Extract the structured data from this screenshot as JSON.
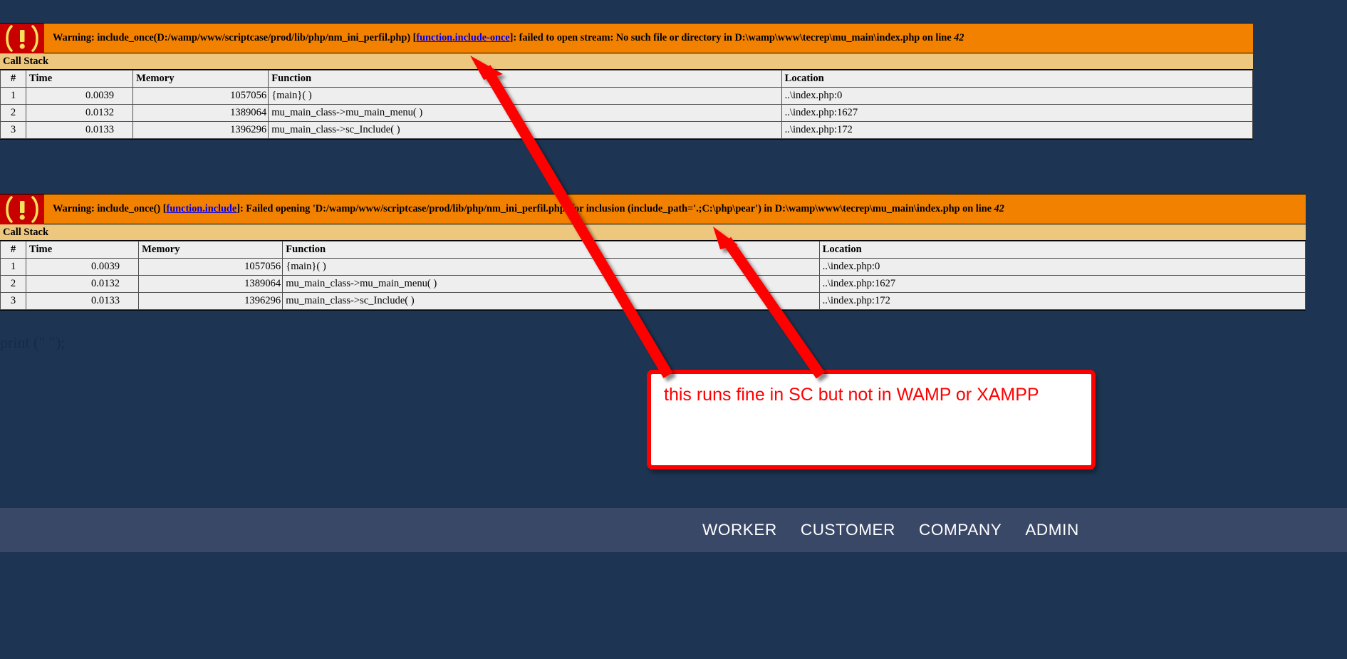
{
  "page": {
    "background_color": "#1d3553",
    "print_statement": "print (\" \");"
  },
  "errors": [
    {
      "icon": "warning-exclamation-icon",
      "warning_prefix": "Warning: include_once(D:/wamp/www/scriptcase/prod/lib/php/nm_ini_perfil.php) [",
      "link_text": "function.include-once",
      "warning_suffix": "]: failed to open stream: No such file or directory in D:\\wamp\\www\\tecrep\\mu_main\\index.php on line ",
      "line_number": "42",
      "callstack_title": "Call Stack",
      "columns": [
        "#",
        "Time",
        "Memory",
        "Function",
        "Location"
      ],
      "rows": [
        {
          "num": "1",
          "time": "0.0039",
          "memory": "1057056",
          "function": "{main}( )",
          "location": "..\\index.php:0"
        },
        {
          "num": "2",
          "time": "0.0132",
          "memory": "1389064",
          "function": "mu_main_class->mu_main_menu( )",
          "location": "..\\index.php:1627"
        },
        {
          "num": "3",
          "time": "0.0133",
          "memory": "1396296",
          "function": "mu_main_class->sc_Include( )",
          "location": "..\\index.php:172"
        }
      ]
    },
    {
      "icon": "warning-exclamation-icon",
      "warning_prefix": "Warning: include_once() [",
      "link_text": "function.include",
      "warning_suffix": "]: Failed opening 'D:/wamp/www/scriptcase/prod/lib/php/nm_ini_perfil.php' for inclusion (include_path='.;C:\\php\\pear') in D:\\wamp\\www\\tecrep\\mu_main\\index.php on line ",
      "line_number": "42",
      "callstack_title": "Call Stack",
      "columns": [
        "#",
        "Time",
        "Memory",
        "Function",
        "Location"
      ],
      "rows": [
        {
          "num": "1",
          "time": "0.0039",
          "memory": "1057056",
          "function": "{main}( )",
          "location": "..\\index.php:0"
        },
        {
          "num": "2",
          "time": "0.0132",
          "memory": "1389064",
          "function": "mu_main_class->mu_main_menu( )",
          "location": "..\\index.php:1627"
        },
        {
          "num": "3",
          "time": "0.0133",
          "memory": "1396296",
          "function": "mu_main_class->sc_Include( )",
          "location": "..\\index.php:172"
        }
      ]
    }
  ],
  "annotation": {
    "text": "this runs fine in SC but not in WAMP or XAMPP",
    "color": "#ff0000",
    "arrow_color": "#ff0000"
  },
  "bottom_nav": {
    "background_color": "#3a4868",
    "items": [
      {
        "label": "WORKER"
      },
      {
        "label": "CUSTOMER"
      },
      {
        "label": "COMPANY"
      },
      {
        "label": "ADMIN"
      }
    ]
  }
}
